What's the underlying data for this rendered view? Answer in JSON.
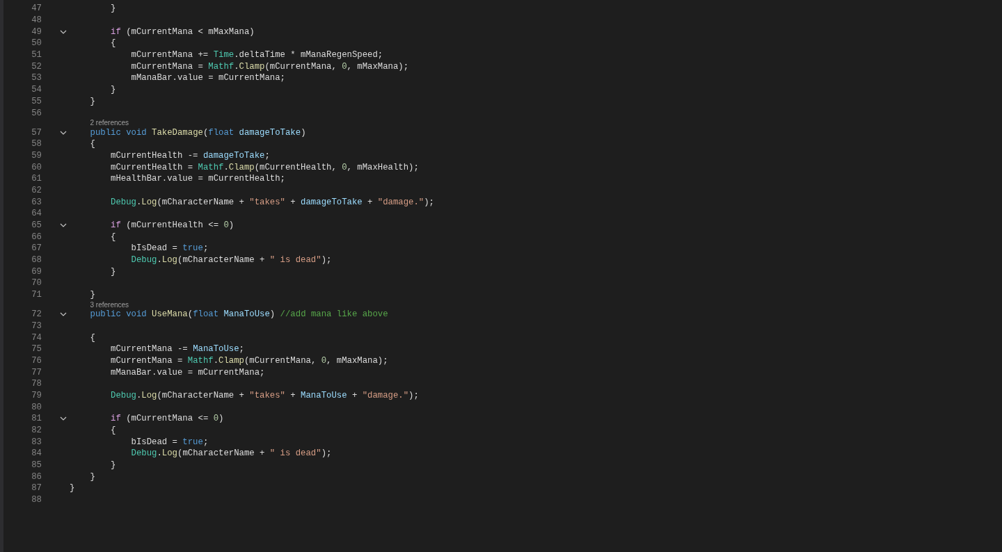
{
  "editor": {
    "lines": [
      {
        "kind": "code",
        "number": "47",
        "tokens": [
          {
            "text": "        }",
            "kind": "plain"
          }
        ]
      },
      {
        "kind": "code",
        "number": "48"
      },
      {
        "kind": "code",
        "number": "49",
        "expanded": true,
        "tokens": [
          {
            "text": "        if",
            "kind": "control"
          },
          {
            "text": " (mCurrentMana < mMaxMana)",
            "kind": "plain"
          }
        ]
      },
      {
        "kind": "code",
        "number": "50",
        "tokens": [
          {
            "text": "        {",
            "kind": "plain"
          }
        ]
      },
      {
        "kind": "code",
        "number": "51",
        "tokens": [
          {
            "text": "            mCurrentMana += ",
            "kind": "plain"
          },
          {
            "text": "Time",
            "kind": "type"
          },
          {
            "text": ".deltaTime * mManaRegenSpeed;",
            "kind": "plain"
          }
        ]
      },
      {
        "kind": "code",
        "number": "52",
        "tokens": [
          {
            "text": "            mCurrentMana = ",
            "kind": "plain"
          },
          {
            "text": "Mathf",
            "kind": "type"
          },
          {
            "text": ".",
            "kind": "plain"
          },
          {
            "text": "Clamp",
            "kind": "method"
          },
          {
            "text": "(mCurrentMana, ",
            "kind": "plain"
          },
          {
            "text": "0",
            "kind": "number"
          },
          {
            "text": ", mMaxMana);",
            "kind": "plain"
          }
        ]
      },
      {
        "kind": "code",
        "number": "53",
        "tokens": [
          {
            "text": "            mManaBar.value = mCurrentMana;",
            "kind": "plain"
          }
        ]
      },
      {
        "kind": "code",
        "number": "54",
        "tokens": [
          {
            "text": "        }",
            "kind": "plain"
          }
        ]
      },
      {
        "kind": "code",
        "number": "55",
        "tokens": [
          {
            "text": "    }",
            "kind": "plain"
          }
        ]
      },
      {
        "kind": "code",
        "number": "56"
      },
      {
        "kind": "codelens",
        "text": "2 references"
      },
      {
        "kind": "code",
        "number": "57",
        "expanded": true,
        "tokens": [
          {
            "text": "    public void ",
            "kind": "keyword"
          },
          {
            "text": "TakeDamage",
            "kind": "method"
          },
          {
            "text": "(",
            "kind": "plain"
          },
          {
            "text": "float ",
            "kind": "keyword"
          },
          {
            "text": "damageToTake",
            "kind": "param"
          },
          {
            "text": ")",
            "kind": "plain"
          }
        ]
      },
      {
        "kind": "code",
        "number": "58",
        "tokens": [
          {
            "text": "    {",
            "kind": "plain"
          }
        ]
      },
      {
        "kind": "code",
        "number": "59",
        "tokens": [
          {
            "text": "        mCurrentHealth -= ",
            "kind": "plain"
          },
          {
            "text": "damageToTake",
            "kind": "param"
          },
          {
            "text": ";",
            "kind": "plain"
          }
        ]
      },
      {
        "kind": "code",
        "number": "60",
        "tokens": [
          {
            "text": "        mCurrentHealth = ",
            "kind": "plain"
          },
          {
            "text": "Mathf",
            "kind": "type"
          },
          {
            "text": ".",
            "kind": "plain"
          },
          {
            "text": "Clamp",
            "kind": "method"
          },
          {
            "text": "(mCurrentHealth, ",
            "kind": "plain"
          },
          {
            "text": "0",
            "kind": "number"
          },
          {
            "text": ", mMaxHealth);",
            "kind": "plain"
          }
        ]
      },
      {
        "kind": "code",
        "number": "61",
        "tokens": [
          {
            "text": "        mHealthBar.value = mCurrentHealth;",
            "kind": "plain"
          }
        ]
      },
      {
        "kind": "code",
        "number": "62"
      },
      {
        "kind": "code",
        "number": "63",
        "tokens": [
          {
            "text": "        Debug",
            "kind": "type"
          },
          {
            "text": ".",
            "kind": "plain"
          },
          {
            "text": "Log",
            "kind": "method"
          },
          {
            "text": "(mCharacterName + ",
            "kind": "plain"
          },
          {
            "text": "\"takes\"",
            "kind": "string"
          },
          {
            "text": " + ",
            "kind": "plain"
          },
          {
            "text": "damageToTake",
            "kind": "param"
          },
          {
            "text": " + ",
            "kind": "plain"
          },
          {
            "text": "\"damage.\"",
            "kind": "string"
          },
          {
            "text": ");",
            "kind": "plain"
          }
        ]
      },
      {
        "kind": "code",
        "number": "64"
      },
      {
        "kind": "code",
        "number": "65",
        "expanded": true,
        "tokens": [
          {
            "text": "        if",
            "kind": "control"
          },
          {
            "text": " (mCurrentHealth <= ",
            "kind": "plain"
          },
          {
            "text": "0",
            "kind": "number"
          },
          {
            "text": ")",
            "kind": "plain"
          }
        ]
      },
      {
        "kind": "code",
        "number": "66",
        "tokens": [
          {
            "text": "        {",
            "kind": "plain"
          }
        ]
      },
      {
        "kind": "code",
        "number": "67",
        "tokens": [
          {
            "text": "            bIsDead = ",
            "kind": "plain"
          },
          {
            "text": "true",
            "kind": "keyword"
          },
          {
            "text": ";",
            "kind": "plain"
          }
        ]
      },
      {
        "kind": "code",
        "number": "68",
        "tokens": [
          {
            "text": "            Debug",
            "kind": "type"
          },
          {
            "text": ".",
            "kind": "plain"
          },
          {
            "text": "Log",
            "kind": "method"
          },
          {
            "text": "(mCharacterName + ",
            "kind": "plain"
          },
          {
            "text": "\" is dead\"",
            "kind": "string"
          },
          {
            "text": ");",
            "kind": "plain"
          }
        ]
      },
      {
        "kind": "code",
        "number": "69",
        "tokens": [
          {
            "text": "        }",
            "kind": "plain"
          }
        ]
      },
      {
        "kind": "code",
        "number": "70"
      },
      {
        "kind": "code",
        "number": "71",
        "tokens": [
          {
            "text": "    }",
            "kind": "plain"
          }
        ]
      },
      {
        "kind": "codelens",
        "text": "3 references"
      },
      {
        "kind": "code",
        "number": "72",
        "expanded": true,
        "tokens": [
          {
            "text": "    public void ",
            "kind": "keyword"
          },
          {
            "text": "UseMana",
            "kind": "method"
          },
          {
            "text": "(",
            "kind": "plain"
          },
          {
            "text": "float ",
            "kind": "keyword"
          },
          {
            "text": "ManaToUse",
            "kind": "param"
          },
          {
            "text": ") ",
            "kind": "plain"
          },
          {
            "text": "//add mana like above",
            "kind": "comment"
          }
        ]
      },
      {
        "kind": "code",
        "number": "73"
      },
      {
        "kind": "code",
        "number": "74",
        "tokens": [
          {
            "text": "    {",
            "kind": "plain"
          }
        ]
      },
      {
        "kind": "code",
        "number": "75",
        "tokens": [
          {
            "text": "        mCurrentMana -= ",
            "kind": "plain"
          },
          {
            "text": "ManaToUse",
            "kind": "param"
          },
          {
            "text": ";",
            "kind": "plain"
          }
        ]
      },
      {
        "kind": "code",
        "number": "76",
        "tokens": [
          {
            "text": "        mCurrentMana = ",
            "kind": "plain"
          },
          {
            "text": "Mathf",
            "kind": "type"
          },
          {
            "text": ".",
            "kind": "plain"
          },
          {
            "text": "Clamp",
            "kind": "method"
          },
          {
            "text": "(mCurrentMana, ",
            "kind": "plain"
          },
          {
            "text": "0",
            "kind": "number"
          },
          {
            "text": ", mMaxMana);",
            "kind": "plain"
          }
        ]
      },
      {
        "kind": "code",
        "number": "77",
        "tokens": [
          {
            "text": "        mManaBar.value = mCurrentMana;",
            "kind": "plain"
          }
        ]
      },
      {
        "kind": "code",
        "number": "78"
      },
      {
        "kind": "code",
        "number": "79",
        "tokens": [
          {
            "text": "        Debug",
            "kind": "type"
          },
          {
            "text": ".",
            "kind": "plain"
          },
          {
            "text": "Log",
            "kind": "method"
          },
          {
            "text": "(mCharacterName + ",
            "kind": "plain"
          },
          {
            "text": "\"takes\"",
            "kind": "string"
          },
          {
            "text": " + ",
            "kind": "plain"
          },
          {
            "text": "ManaToUse",
            "kind": "param"
          },
          {
            "text": " + ",
            "kind": "plain"
          },
          {
            "text": "\"damage.\"",
            "kind": "string"
          },
          {
            "text": ");",
            "kind": "plain"
          }
        ]
      },
      {
        "kind": "code",
        "number": "80"
      },
      {
        "kind": "code",
        "number": "81",
        "expanded": true,
        "tokens": [
          {
            "text": "        if",
            "kind": "control"
          },
          {
            "text": " (mCurrentMana <= ",
            "kind": "plain"
          },
          {
            "text": "0",
            "kind": "number"
          },
          {
            "text": ")",
            "kind": "plain"
          }
        ]
      },
      {
        "kind": "code",
        "number": "82",
        "tokens": [
          {
            "text": "        {",
            "kind": "plain"
          }
        ]
      },
      {
        "kind": "code",
        "number": "83",
        "tokens": [
          {
            "text": "            bIsDead = ",
            "kind": "plain"
          },
          {
            "text": "true",
            "kind": "keyword"
          },
          {
            "text": ";",
            "kind": "plain"
          }
        ]
      },
      {
        "kind": "code",
        "number": "84",
        "tokens": [
          {
            "text": "            Debug",
            "kind": "type"
          },
          {
            "text": ".",
            "kind": "plain"
          },
          {
            "text": "Log",
            "kind": "method"
          },
          {
            "text": "(mCharacterName + ",
            "kind": "plain"
          },
          {
            "text": "\" is dead\"",
            "kind": "string"
          },
          {
            "text": ");",
            "kind": "plain"
          }
        ]
      },
      {
        "kind": "code",
        "number": "85",
        "tokens": [
          {
            "text": "        }",
            "kind": "plain"
          }
        ]
      },
      {
        "kind": "code",
        "number": "86",
        "tokens": [
          {
            "text": "    }",
            "kind": "plain"
          }
        ]
      },
      {
        "kind": "code",
        "number": "87",
        "tokens": [
          {
            "text": "}",
            "kind": "plain"
          }
        ]
      },
      {
        "kind": "code",
        "number": "88"
      }
    ]
  }
}
